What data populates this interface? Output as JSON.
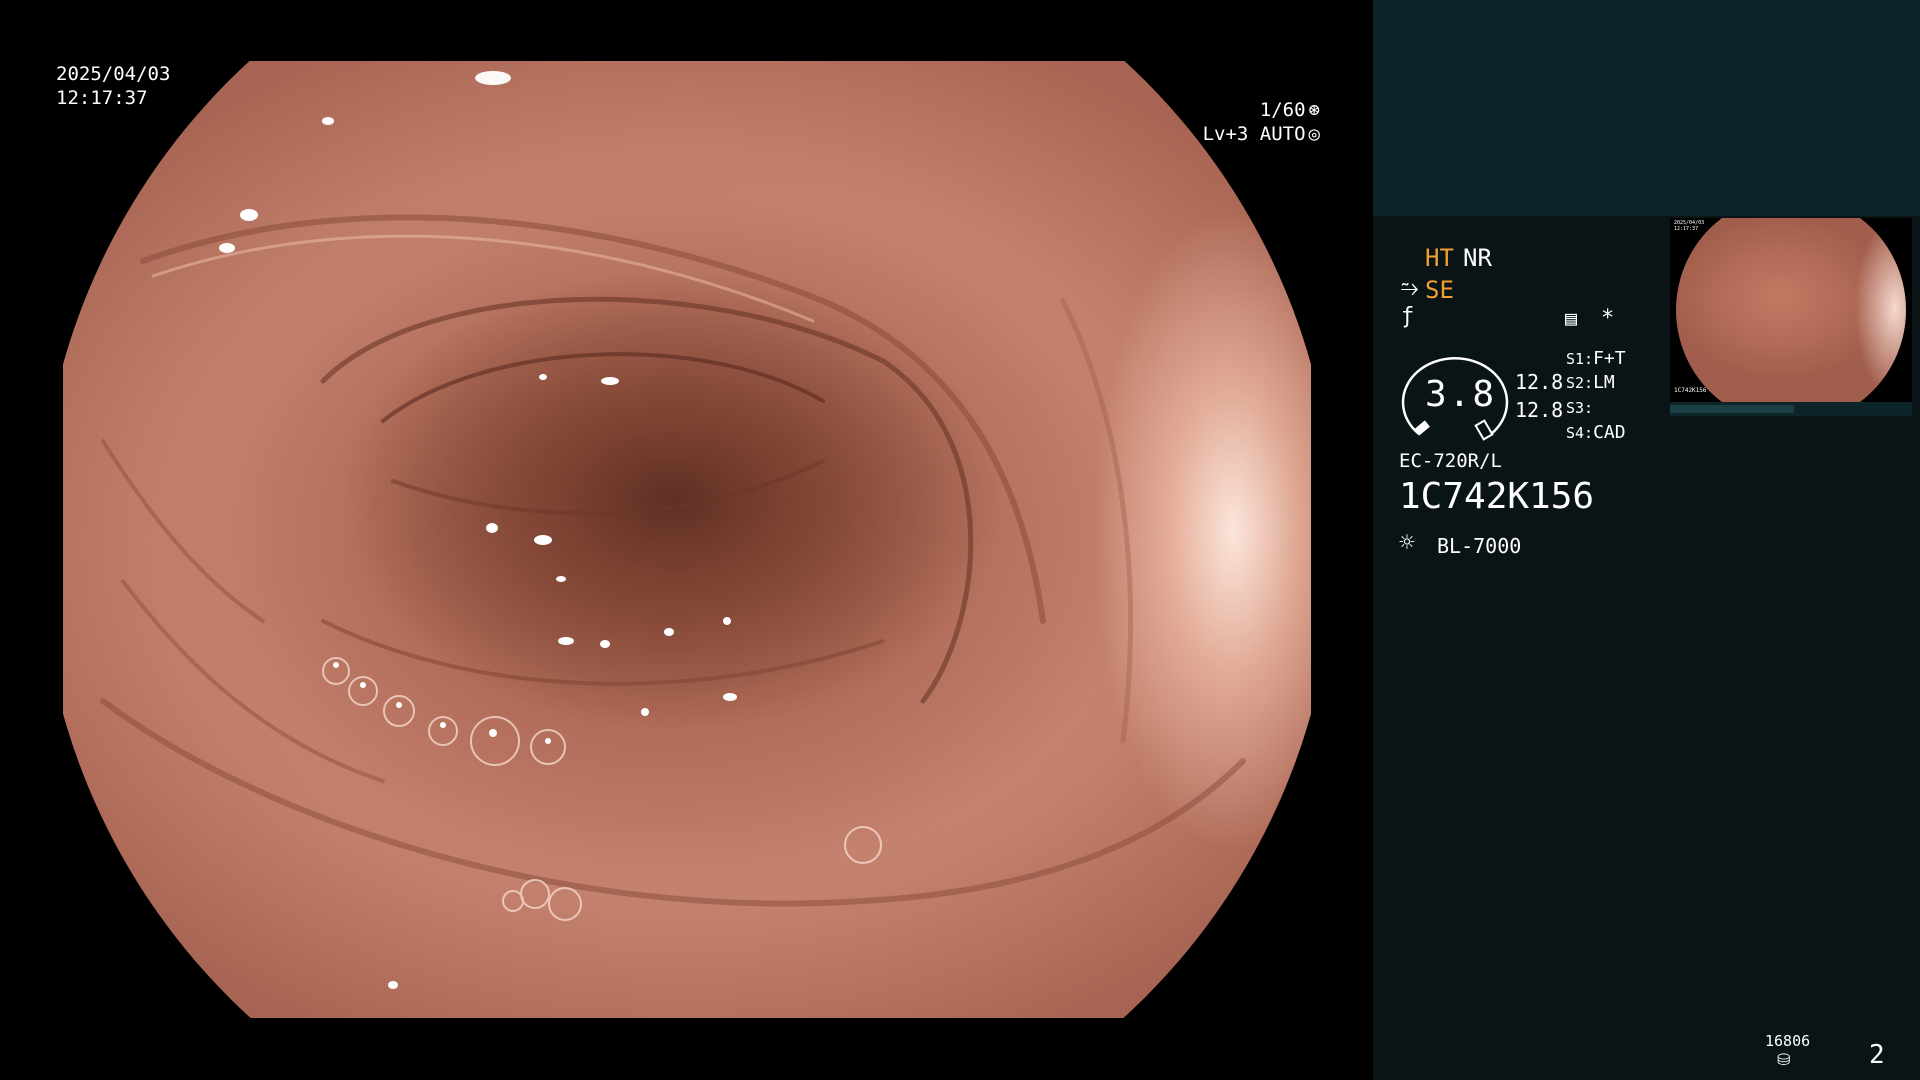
{
  "overlay": {
    "date": "2025/04/03",
    "time": "12:17:37",
    "shutter": "1/60",
    "shutter_icon": "aperture-icon",
    "level": "Lv+3",
    "mode": "AUTO",
    "mode_icon": "auto-iris-icon"
  },
  "panel": {
    "ht": "HT",
    "nr": "NR",
    "se": "SE",
    "se_icon": "structure-enhance-icon",
    "f_icon": "freeze-icon",
    "memo_icon": "memo-icon",
    "star": "*",
    "zoom_value": "3.8",
    "values": [
      "12.8",
      "12.8"
    ],
    "switches": [
      {
        "key": "S1:",
        "value": "F+T"
      },
      {
        "key": "S2:",
        "value": "LM"
      },
      {
        "key": "S3:",
        "value": ""
      },
      {
        "key": "S4:",
        "value": "CAD"
      }
    ],
    "scope_model": "EC-720R/L",
    "scope_serial": "1C742K156",
    "light_icon": "light-source-icon",
    "light_source": "BL-7000",
    "image_count": "16806",
    "count_icon": "storage-icon",
    "page_number": "2",
    "colors": {
      "accent": "#f0a030",
      "panel_bg": "#0a1416",
      "panel_top": "#0d2529"
    }
  },
  "thumbnail": {
    "date": "2025/04/03",
    "time": "12:17:37",
    "serial": "1C742K156"
  }
}
